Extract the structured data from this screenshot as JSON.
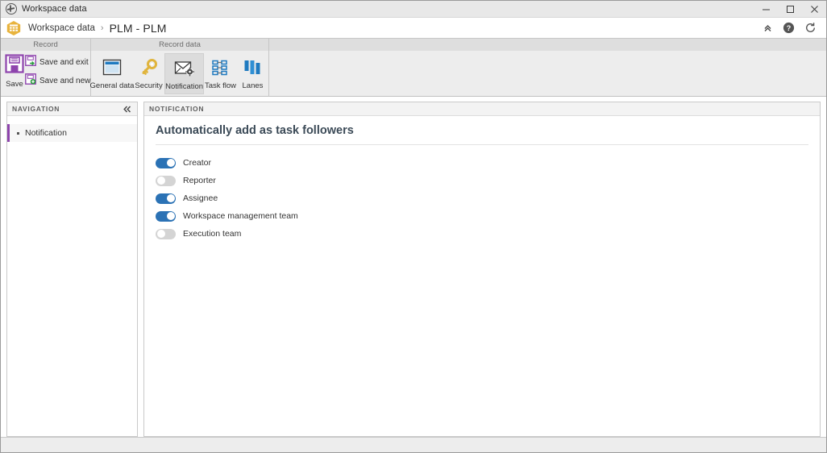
{
  "window": {
    "title": "Workspace data",
    "icon": "globe-icon",
    "controls": {
      "minimize": "minimize-icon",
      "maximize": "maximize-icon",
      "close": "close-icon"
    }
  },
  "breadcrumb": {
    "app_icon": "workspace-hex-icon",
    "parent": "Workspace data",
    "separator": "›",
    "current": "PLM - PLM",
    "actions": [
      {
        "name": "collapse-ribbon-icon",
        "glyph": "chevrons-up"
      },
      {
        "name": "help-icon",
        "glyph": "question-circle"
      },
      {
        "name": "refresh-icon",
        "glyph": "refresh-arrow"
      }
    ]
  },
  "ribbon": {
    "groups": [
      {
        "label": "Record"
      },
      {
        "label": "Record data"
      },
      {
        "label": ""
      }
    ],
    "record": {
      "save": {
        "label": "Save",
        "icon": "save-floppy-icon"
      },
      "save_and_exit": {
        "label": "Save and exit",
        "icon": "save-exit-icon"
      },
      "save_and_new": {
        "label": "Save and new",
        "icon": "save-new-icon"
      }
    },
    "record_data": [
      {
        "label": "General data",
        "icon": "window-icon",
        "selected": false
      },
      {
        "label": "Security",
        "icon": "key-icon",
        "selected": false
      },
      {
        "label": "Notification",
        "icon": "envelope-gear-icon",
        "selected": true
      },
      {
        "label": "Task flow",
        "icon": "task-grid-icon",
        "selected": false
      },
      {
        "label": "Lanes",
        "icon": "lanes-bars-icon",
        "selected": false
      }
    ]
  },
  "navigation": {
    "header": "NAVIGATION",
    "collapse_icon": "chevrons-left-icon",
    "items": [
      {
        "label": "Notification",
        "selected": true
      }
    ]
  },
  "content": {
    "header": "NOTIFICATION",
    "section_title": "Automatically add as task followers",
    "toggles": [
      {
        "label": "Creator",
        "state": "on"
      },
      {
        "label": "Reporter",
        "state": "off"
      },
      {
        "label": "Assignee",
        "state": "on"
      },
      {
        "label": "Workspace management team",
        "state": "on"
      },
      {
        "label": "Execution team",
        "state": "off"
      }
    ]
  },
  "colors": {
    "accent_purple": "#8e44ad",
    "toggle_on_blue": "#2b72b5",
    "toggle_off_gray": "#d4d4d4",
    "hex_icon_orange": "#e8b33d",
    "icon_blue": "#1f7ac0"
  }
}
